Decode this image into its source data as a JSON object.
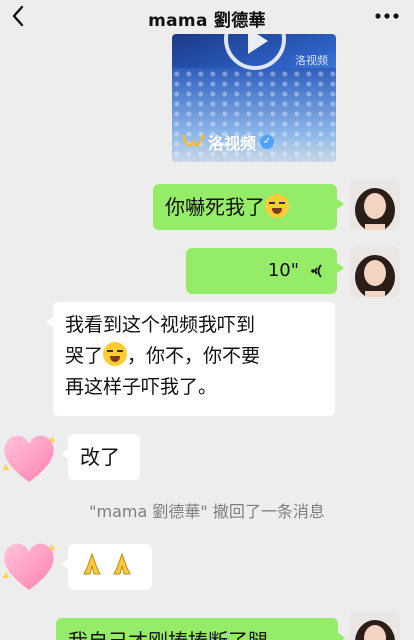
{
  "header": {
    "title": "mama 劉德華"
  },
  "video": {
    "brand": "洛视频",
    "watermark": "洛视频"
  },
  "messages": [
    {
      "side": "right",
      "text": "你嚇死我了"
    },
    {
      "side": "right",
      "voice_duration": "10\""
    },
    {
      "side": "left",
      "lines": [
        "我看到这个视频我吓到",
        "哭了",
        "，你不，你不要",
        "再这样子吓我了。"
      ]
    },
    {
      "side": "left",
      "text": "改了"
    },
    {
      "side": "left",
      "emoji": "pray-pray"
    },
    {
      "side": "right",
      "text": "我自己才刚捧捧断了腿"
    }
  ],
  "system_notice": "\"mama 劉德華\" 撤回了一条消息",
  "colors": {
    "green_bubble": "#95ec69",
    "background": "#ededed"
  }
}
